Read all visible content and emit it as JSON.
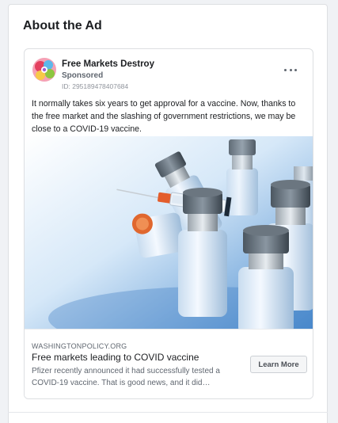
{
  "panel": {
    "title": "About the Ad"
  },
  "ad": {
    "page_name": "Free Markets Destroy",
    "sponsored_label": "Sponsored",
    "ad_id": "ID: 295189478407684",
    "body": "It normally takes six years to get approval for a vaccine. Now, thanks to the free market and the slashing of government restrictions, we may be close to a COVID-19 vaccine.",
    "image_alt": "vaccine vials and syringe",
    "link": {
      "domain": "WASHINGTONPOLICY.ORG",
      "headline": "Free markets leading to COVID vaccine",
      "description": "Pfizer recently announced it had successfully tested a COVID-19 vaccine. That is good news, and it did…",
      "cta_label": "Learn More"
    }
  },
  "icons": {
    "more": "more-horizontal-icon"
  }
}
